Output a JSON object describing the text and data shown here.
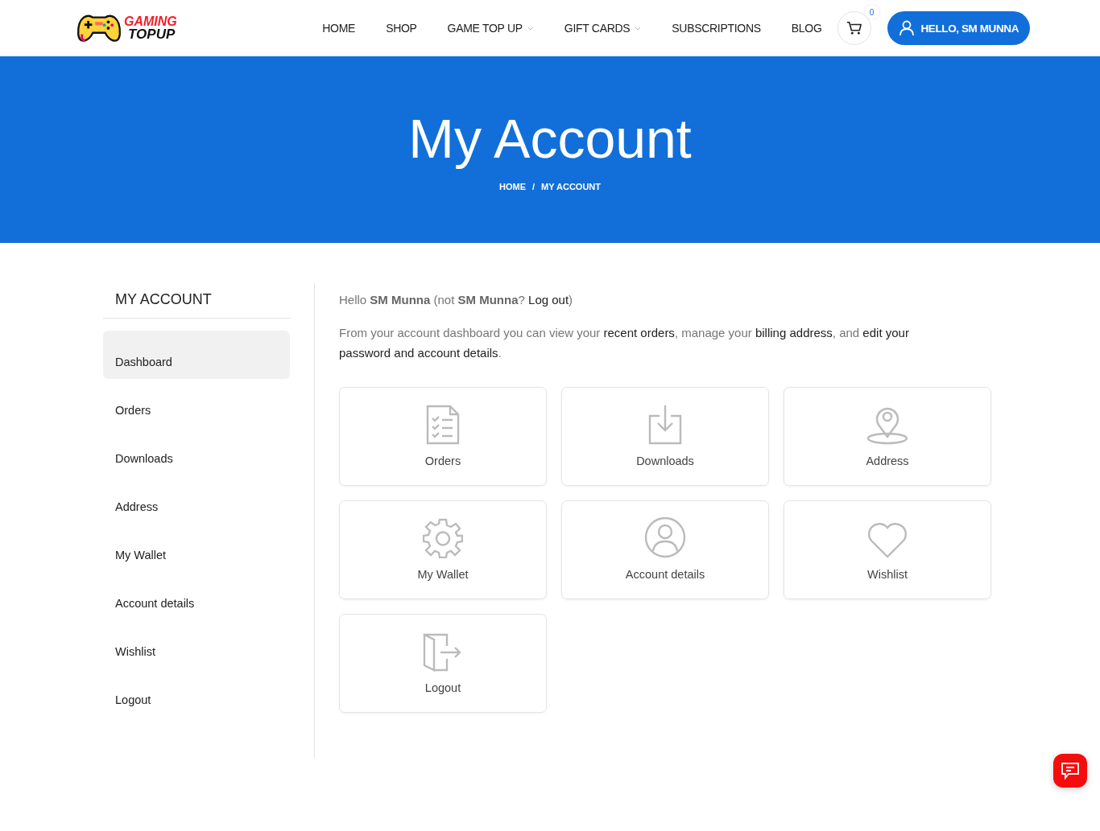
{
  "logo": {
    "line_1": "GAMING",
    "line_2": "TOPUP"
  },
  "nav": [
    {
      "label": "HOME",
      "dropdown": false
    },
    {
      "label": "SHOP",
      "dropdown": false
    },
    {
      "label": "GAME TOP UP",
      "dropdown": true
    },
    {
      "label": "GIFT CARDS",
      "dropdown": true
    },
    {
      "label": "SUBSCRIPTIONS",
      "dropdown": false
    },
    {
      "label": "BLOG",
      "dropdown": false
    }
  ],
  "cart": {
    "count": "0"
  },
  "account_button": "HELLO, SM MUNNA",
  "hero": {
    "title": "My Account",
    "breadcrumb": [
      "HOME",
      "MY ACCOUNT"
    ],
    "separator": "/"
  },
  "sidebar": {
    "title": "MY ACCOUNT",
    "items": [
      {
        "label": "Dashboard",
        "selected": true
      },
      {
        "label": "Orders",
        "selected": false
      },
      {
        "label": "Downloads",
        "selected": false
      },
      {
        "label": "Address",
        "selected": false
      },
      {
        "label": "My Wallet",
        "selected": false
      },
      {
        "label": "Account details",
        "selected": false
      },
      {
        "label": "Wishlist",
        "selected": false
      },
      {
        "label": "Logout",
        "selected": false
      }
    ]
  },
  "greeting": [
    {
      "text": "Hello ",
      "kind": "plain"
    },
    {
      "text": "SM Munna",
      "kind": "strong"
    },
    {
      "text": " (not ",
      "kind": "plain"
    },
    {
      "text": "SM Munna",
      "kind": "strong"
    },
    {
      "text": "? ",
      "kind": "plain"
    },
    {
      "text": "Log out",
      "kind": "link"
    },
    {
      "text": ")",
      "kind": "plain"
    }
  ],
  "intro": [
    {
      "text": "From your account dashboard you can view your ",
      "kind": "plain"
    },
    {
      "text": "recent orders",
      "kind": "link"
    },
    {
      "text": ", manage your ",
      "kind": "plain"
    },
    {
      "text": "billing address",
      "kind": "link"
    },
    {
      "text": ", and ",
      "kind": "plain"
    },
    {
      "text": "edit your",
      "kind": "link"
    },
    {
      "text": "password and account details",
      "kind": "link"
    },
    {
      "text": ".",
      "kind": "plain"
    }
  ],
  "tiles": [
    {
      "label": "Orders",
      "kind": "orders"
    },
    {
      "label": "Downloads",
      "kind": "downloads"
    },
    {
      "label": "Address",
      "kind": "address"
    },
    {
      "label": "My Wallet",
      "kind": "wallet"
    },
    {
      "label": "Account details",
      "kind": "account"
    },
    {
      "label": "Wishlist",
      "kind": "wishlist"
    },
    {
      "label": "Logout",
      "kind": "logout"
    }
  ]
}
